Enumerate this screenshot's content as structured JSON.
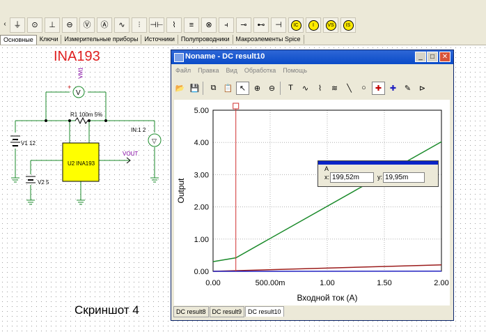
{
  "toolbar": {
    "tools": [
      {
        "icon": "ground-icon",
        "glyph": "⏚"
      },
      {
        "icon": "voltmeter-icon",
        "glyph": "⊙"
      },
      {
        "icon": "battery-icon",
        "glyph": "⊥"
      },
      {
        "icon": "voltage-source-icon",
        "glyph": "⊖"
      },
      {
        "icon": "voltmeter-v-icon",
        "glyph": "Ⓥ"
      },
      {
        "icon": "ammeter-a-icon",
        "glyph": "Ⓐ"
      },
      {
        "icon": "resistor-icon",
        "glyph": "∿"
      },
      {
        "icon": "potentiometer-icon",
        "glyph": "⫶"
      },
      {
        "icon": "capacitor-icon",
        "glyph": "⊣⊢"
      },
      {
        "icon": "inductor-icon",
        "glyph": "⌇"
      },
      {
        "icon": "transformer-icon",
        "glyph": "≡"
      },
      {
        "icon": "relay-icon",
        "glyph": "⊗"
      },
      {
        "icon": "switch-icon",
        "glyph": "⫞"
      },
      {
        "icon": "pushbutton-icon",
        "glyph": "⊸"
      },
      {
        "icon": "fuse-icon",
        "glyph": "⊷"
      },
      {
        "icon": "lamp-icon",
        "glyph": "⊣"
      }
    ],
    "yellow_tools": [
      {
        "icon": "ic-source-icon",
        "text": "IC"
      },
      {
        "icon": "current-source-icon",
        "text": "I"
      },
      {
        "icon": "vs-icon",
        "text": "VS"
      },
      {
        "icon": "is-icon",
        "text": "IS"
      }
    ]
  },
  "tabs": [
    "Основные",
    "Ключи",
    "Измерительные приборы",
    "Источники",
    "Полупроводники",
    "Макроэлементы Spice"
  ],
  "schematic": {
    "title": "INA193",
    "labels": {
      "vm1": "VM1",
      "r1": "R1 100m 5%",
      "v1": "V1 12",
      "v2": "V2 5",
      "u2": "U2 INA193",
      "vout": "VOUT",
      "in1": "IN:1 2"
    }
  },
  "caption": "Скриншот 4",
  "window": {
    "title": "Noname - DC result10",
    "menu": [
      "Файл",
      "Правка",
      "Вид",
      "Обработка",
      "Помощь"
    ],
    "bottom_tabs": [
      "DC result8",
      "DC result9",
      "DC result10"
    ],
    "active_tab": "DC result10",
    "cursor": {
      "name": "A",
      "x_label": "x:",
      "x_value": "199,52m",
      "y_label": "y:",
      "y_value": "19,95m"
    }
  },
  "chart_data": {
    "type": "line",
    "xlabel": "Входной ток (A)",
    "ylabel": "Output",
    "xlim": [
      0,
      2
    ],
    "ylim": [
      0,
      5
    ],
    "x_ticks": [
      "0.00",
      "500.00m",
      "1.00",
      "1.50",
      "2.00"
    ],
    "y_ticks": [
      "0.00",
      "1.00",
      "2.00",
      "3.00",
      "4.00",
      "5.00"
    ],
    "grid": true,
    "cursor_x": 0.1995,
    "series": [
      {
        "color": "#1a8a2a",
        "x": [
          0,
          0.2,
          2.0
        ],
        "y": [
          0.3,
          0.42,
          4.02
        ]
      },
      {
        "color": "#9a1a1a",
        "x": [
          0,
          2.0
        ],
        "y": [
          0,
          0.2
        ]
      },
      {
        "color": "#2020c0",
        "x": [
          0,
          2.0
        ],
        "y": [
          0,
          0.005
        ]
      }
    ]
  }
}
